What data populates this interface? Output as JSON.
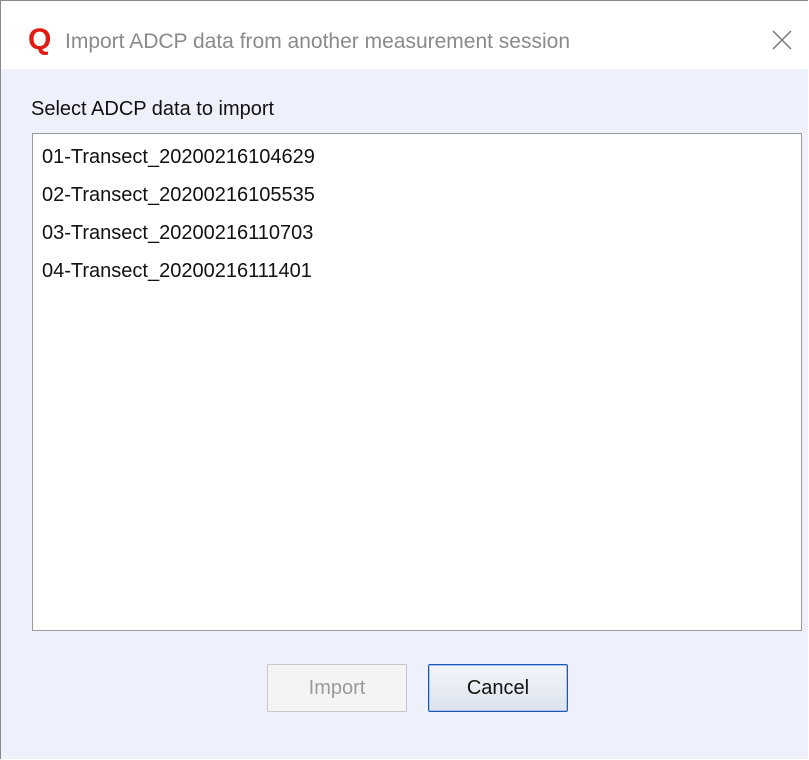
{
  "window": {
    "title": "Import ADCP data from another measurement session",
    "app_icon_letter": "Q",
    "app_icon_color": "#e01b12",
    "close_icon": "close-icon"
  },
  "dialog": {
    "prompt": "Select ADCP data to import",
    "items": [
      "01-Transect_20200216104629",
      "02-Transect_20200216105535",
      "03-Transect_20200216110703",
      "04-Transect_20200216111401"
    ]
  },
  "buttons": {
    "import_label": "Import",
    "import_enabled": false,
    "cancel_label": "Cancel",
    "cancel_focused": true
  }
}
